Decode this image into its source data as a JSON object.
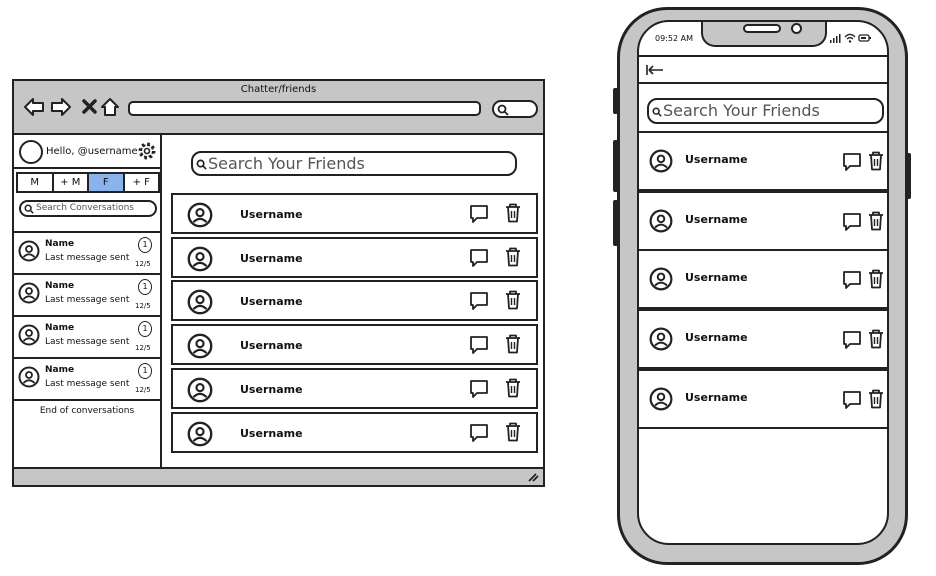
{
  "colors": {
    "chrome_gray": "#c6c6c6",
    "active_filter": "#8ab2ec",
    "outline": "#222222"
  },
  "browser": {
    "title": "Chatter/friends",
    "nav_icons": [
      "back-arrow-icon",
      "forward-arrow-icon",
      "close-icon",
      "home-icon"
    ],
    "address_value": "",
    "search_icon": "search-icon"
  },
  "sidebar": {
    "greeting": "Hello, @username",
    "settings_icon": "gear-icon",
    "filters": [
      "M",
      "+ M",
      "F",
      "+ F"
    ],
    "active_filter": "F",
    "search_placeholder": "Search Conversations",
    "conversations": [
      {
        "name": "Name",
        "last_message": "Last message sent",
        "unread": "1",
        "date": "12/5"
      },
      {
        "name": "Name",
        "last_message": "Last message sent",
        "unread": "1",
        "date": "12/5"
      },
      {
        "name": "Name",
        "last_message": "Last message sent",
        "unread": "1",
        "date": "12/5"
      },
      {
        "name": "Name",
        "last_message": "Last message sent",
        "unread": "1",
        "date": "12/5"
      }
    ],
    "end_label": "End of conversations"
  },
  "main": {
    "search_placeholder": "Search Your Friends",
    "friends": [
      {
        "username": "Username"
      },
      {
        "username": "Username"
      },
      {
        "username": "Username"
      },
      {
        "username": "Username"
      },
      {
        "username": "Username"
      },
      {
        "username": "Username"
      }
    ],
    "row_icons": [
      "user-icon",
      "chat-icon",
      "trash-icon"
    ]
  },
  "phone": {
    "time": "09:52 AM",
    "status_icons": [
      "signal-icon",
      "wifi-icon",
      "battery-icon"
    ],
    "back_icon": "back-arrow-icon",
    "search_placeholder": "Search Your Friends",
    "friends": [
      {
        "username": "Username"
      },
      {
        "username": "Username"
      },
      {
        "username": "Username"
      },
      {
        "username": "Username"
      },
      {
        "username": "Username"
      }
    ]
  }
}
